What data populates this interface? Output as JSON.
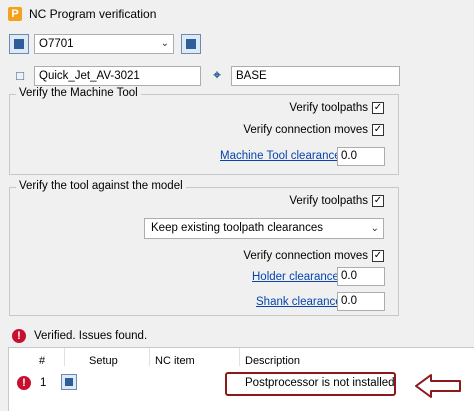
{
  "window": {
    "title": "NC Program verification",
    "app_icon_letter": "P"
  },
  "program_select": {
    "value": "O7701"
  },
  "machine_field": {
    "value": "Quick_Jet_AV-3021"
  },
  "workplane_field": {
    "value": "BASE"
  },
  "machine_group": {
    "title": "Verify the Machine Tool",
    "verify_toolpaths_label": "Verify toolpaths",
    "verify_toolpaths_checked": true,
    "verify_connection_label": "Verify connection moves",
    "verify_connection_checked": true,
    "clearance_link": "Machine Tool clearance",
    "clearance_value": "0.0"
  },
  "model_group": {
    "title": "Verify the tool against the model",
    "verify_toolpaths_label": "Verify toolpaths",
    "verify_toolpaths_checked": true,
    "clearance_mode": "Keep existing toolpath clearances",
    "verify_connection_label": "Verify connection moves",
    "verify_connection_checked": true,
    "holder_link": "Holder clearance",
    "holder_value": "0.0",
    "shank_link": "Shank clearance",
    "shank_value": "0.0"
  },
  "status": {
    "text": "Verified. Issues found."
  },
  "results_table": {
    "headers": [
      "#",
      "Setup",
      "NC item",
      "Description"
    ],
    "rows": [
      {
        "index": "1",
        "setup": "",
        "nc_item": "",
        "description": "Postprocessor is not installed"
      }
    ]
  },
  "colors": {
    "error": "#c8102e",
    "link": "#0645ad",
    "highlight": "#8b1a1a"
  }
}
